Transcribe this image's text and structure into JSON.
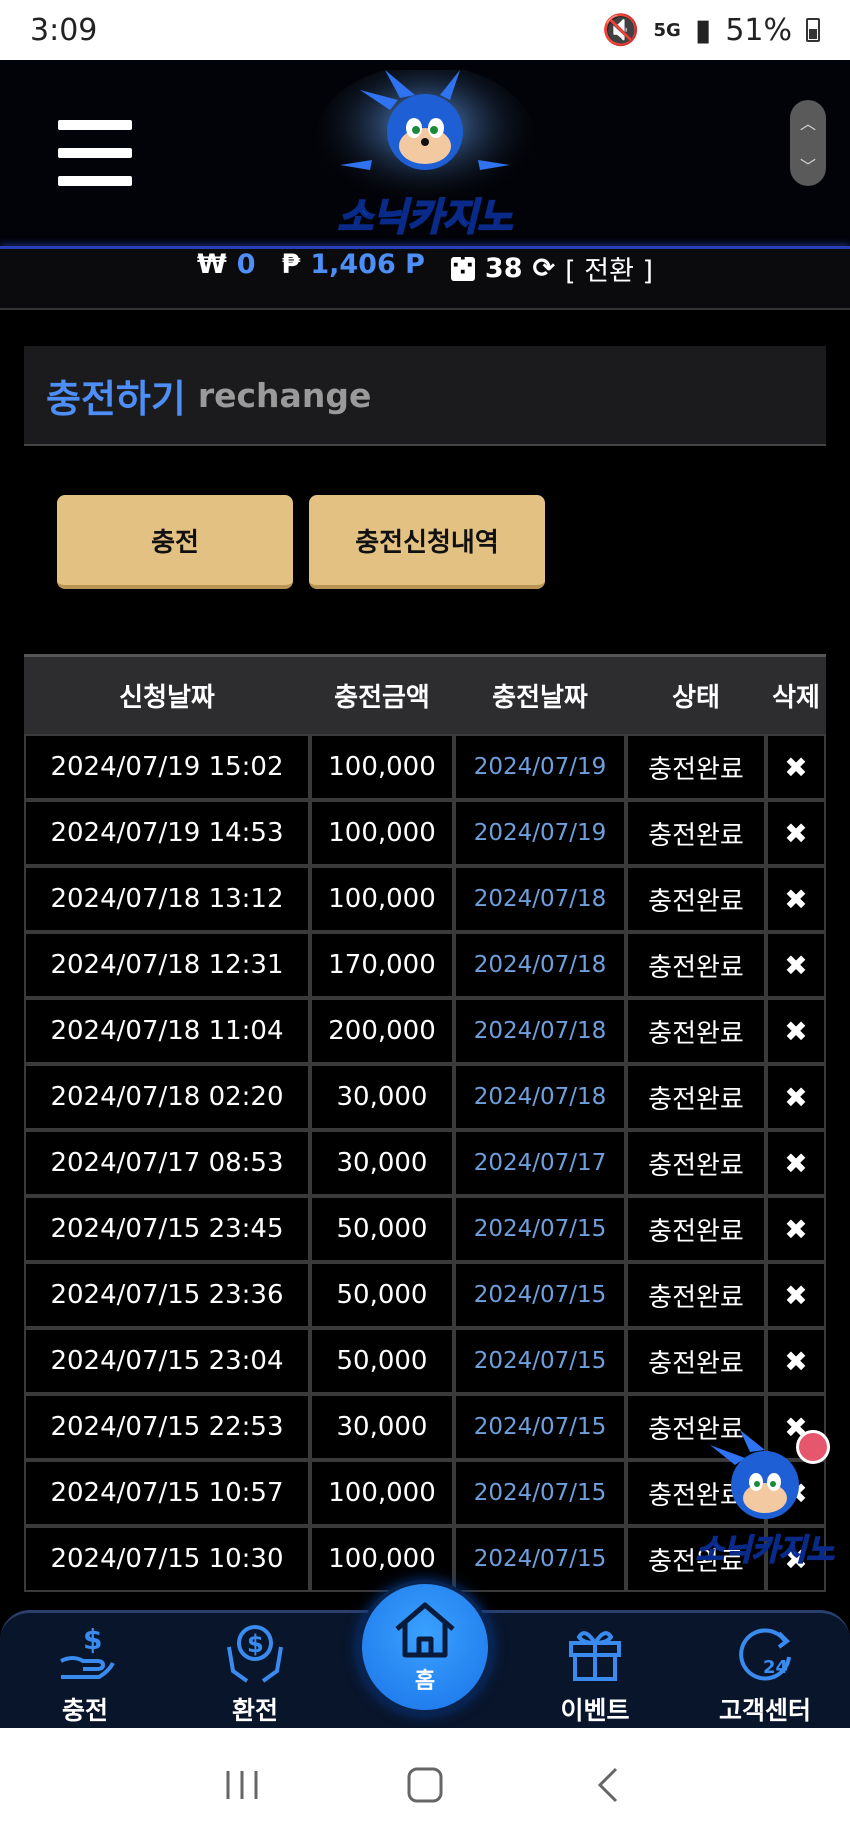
{
  "status": {
    "time": "3:09",
    "network": "5G",
    "battery": "51%"
  },
  "header": {
    "brand": "소닉카지노"
  },
  "balance": {
    "won_symbol": "₩",
    "won": "0",
    "point_symbol": "₱",
    "point": "1,406 P",
    "chips": "38",
    "switch_label": "[ 전환 ]"
  },
  "page": {
    "title_ko": "충전하기",
    "title_en": "rechange"
  },
  "buttons": {
    "charge": "충전",
    "history": "충전신청내역"
  },
  "table": {
    "headers": [
      "신청날짜",
      "충전금액",
      "충전날짜",
      "상태",
      "삭제"
    ],
    "rows": [
      [
        "2024/07/19 15:02",
        "100,000",
        "2024/07/19",
        "충전완료"
      ],
      [
        "2024/07/19 14:53",
        "100,000",
        "2024/07/19",
        "충전완료"
      ],
      [
        "2024/07/18 13:12",
        "100,000",
        "2024/07/18",
        "충전완료"
      ],
      [
        "2024/07/18 12:31",
        "170,000",
        "2024/07/18",
        "충전완료"
      ],
      [
        "2024/07/18 11:04",
        "200,000",
        "2024/07/18",
        "충전완료"
      ],
      [
        "2024/07/18 02:20",
        "30,000",
        "2024/07/18",
        "충전완료"
      ],
      [
        "2024/07/17 08:53",
        "30,000",
        "2024/07/17",
        "충전완료"
      ],
      [
        "2024/07/15 23:45",
        "50,000",
        "2024/07/15",
        "충전완료"
      ],
      [
        "2024/07/15 23:36",
        "50,000",
        "2024/07/15",
        "충전완료"
      ],
      [
        "2024/07/15 23:04",
        "50,000",
        "2024/07/15",
        "충전완료"
      ],
      [
        "2024/07/15 22:53",
        "30,000",
        "2024/07/15",
        "충전완료"
      ],
      [
        "2024/07/15 10:57",
        "100,000",
        "2024/07/15",
        "충전완료"
      ],
      [
        "2024/07/15 10:30",
        "100,000",
        "2024/07/15",
        "충전완료"
      ]
    ],
    "delete_symbol": "✖"
  },
  "bottom_nav": {
    "charge": "충전",
    "exchange": "환전",
    "home": "홈",
    "event": "이벤트",
    "support": "고객센터"
  },
  "colors": {
    "accent": "#4d8ef7",
    "gold": "#e2c182",
    "nav_bg": "#09152b"
  }
}
